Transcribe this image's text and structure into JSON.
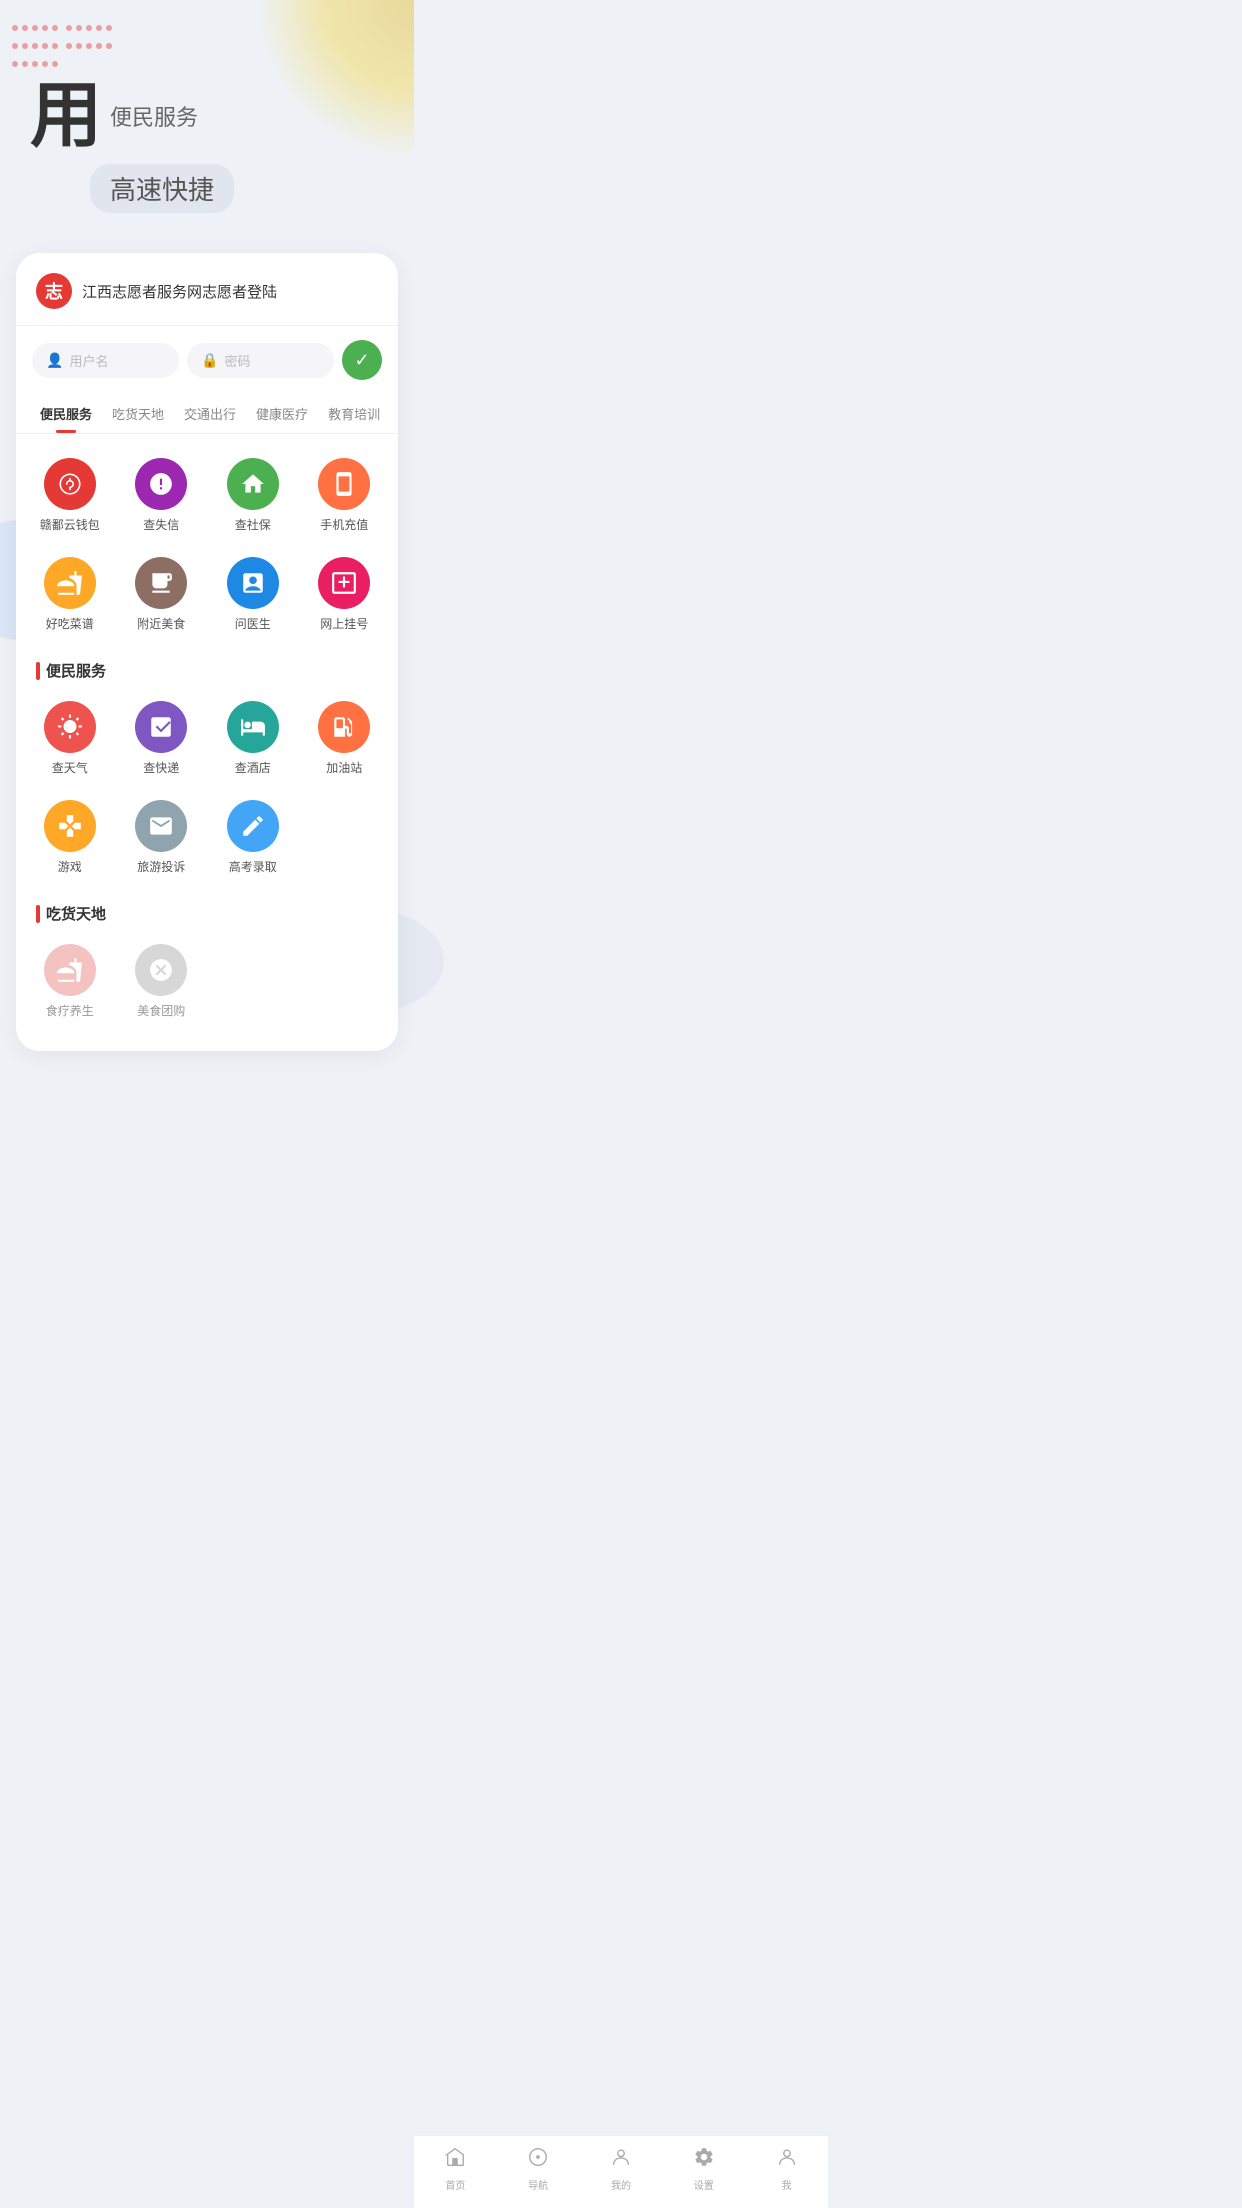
{
  "hero": {
    "char": "用",
    "subtitle": "便民服务",
    "desc": "高速快捷"
  },
  "login": {
    "logo_text": "志",
    "title": "江西志愿者服务网志愿者登陆",
    "username_placeholder": "用户名",
    "password_placeholder": "密码",
    "submit_label": "✓"
  },
  "tabs": [
    {
      "label": "便民服务",
      "active": true
    },
    {
      "label": "吃货天地",
      "active": false
    },
    {
      "label": "交通出行",
      "active": false
    },
    {
      "label": "健康医疗",
      "active": false
    },
    {
      "label": "教育培训",
      "active": false
    }
  ],
  "service_rows": [
    {
      "items": [
        {
          "icon": "💰",
          "color": "ic-red",
          "label": "赣鄱云钱包"
        },
        {
          "icon": "⚠",
          "color": "ic-purple",
          "label": "查失信"
        },
        {
          "icon": "🏠",
          "color": "ic-green",
          "label": "查社保"
        },
        {
          "icon": "📱",
          "color": "ic-orange",
          "label": "手机充值"
        }
      ]
    },
    {
      "items": [
        {
          "icon": "🍱",
          "color": "ic-amber",
          "label": "好吃菜谱"
        },
        {
          "icon": "🍸",
          "color": "ic-brown",
          "label": "附近美食"
        },
        {
          "icon": "➕",
          "color": "ic-blue",
          "label": "问医生"
        },
        {
          "icon": "🖥",
          "color": "ic-pink",
          "label": "网上挂号"
        }
      ]
    }
  ],
  "section1": {
    "title": "便民服务",
    "rows": [
      {
        "items": [
          {
            "icon": "☁",
            "color": "ic-coral",
            "label": "查天气"
          },
          {
            "icon": "📦",
            "color": "ic-lavender",
            "label": "查快递"
          },
          {
            "icon": "🏨",
            "color": "ic-teal",
            "label": "查酒店"
          },
          {
            "icon": "⛽",
            "color": "ic-fuel",
            "label": "加油站"
          }
        ]
      },
      {
        "items": [
          {
            "icon": "🎮",
            "color": "ic-game",
            "label": "游戏"
          },
          {
            "icon": "✉",
            "color": "ic-mail",
            "label": "旅游投诉"
          },
          {
            "icon": "✏",
            "color": "ic-blue",
            "label": "高考录取"
          }
        ]
      }
    ]
  },
  "section2": {
    "title": "吃货天地",
    "rows": [
      {
        "items": [
          {
            "icon": "🌿",
            "color": "ic-food",
            "label": "食疗养生"
          },
          {
            "icon": "✕",
            "color": "ic-deal",
            "label": "美食团购"
          }
        ]
      }
    ]
  },
  "bottom_nav": [
    {
      "icon": "⬜",
      "label": "首页"
    },
    {
      "icon": "◎",
      "label": "导航"
    },
    {
      "icon": "🏠",
      "label": "我的"
    },
    {
      "icon": "⚙",
      "label": "设置"
    },
    {
      "icon": "👤",
      "label": "我"
    }
  ],
  "colors": {
    "accent": "#e53935",
    "green": "#4caf50",
    "bg": "#eef2f7"
  }
}
